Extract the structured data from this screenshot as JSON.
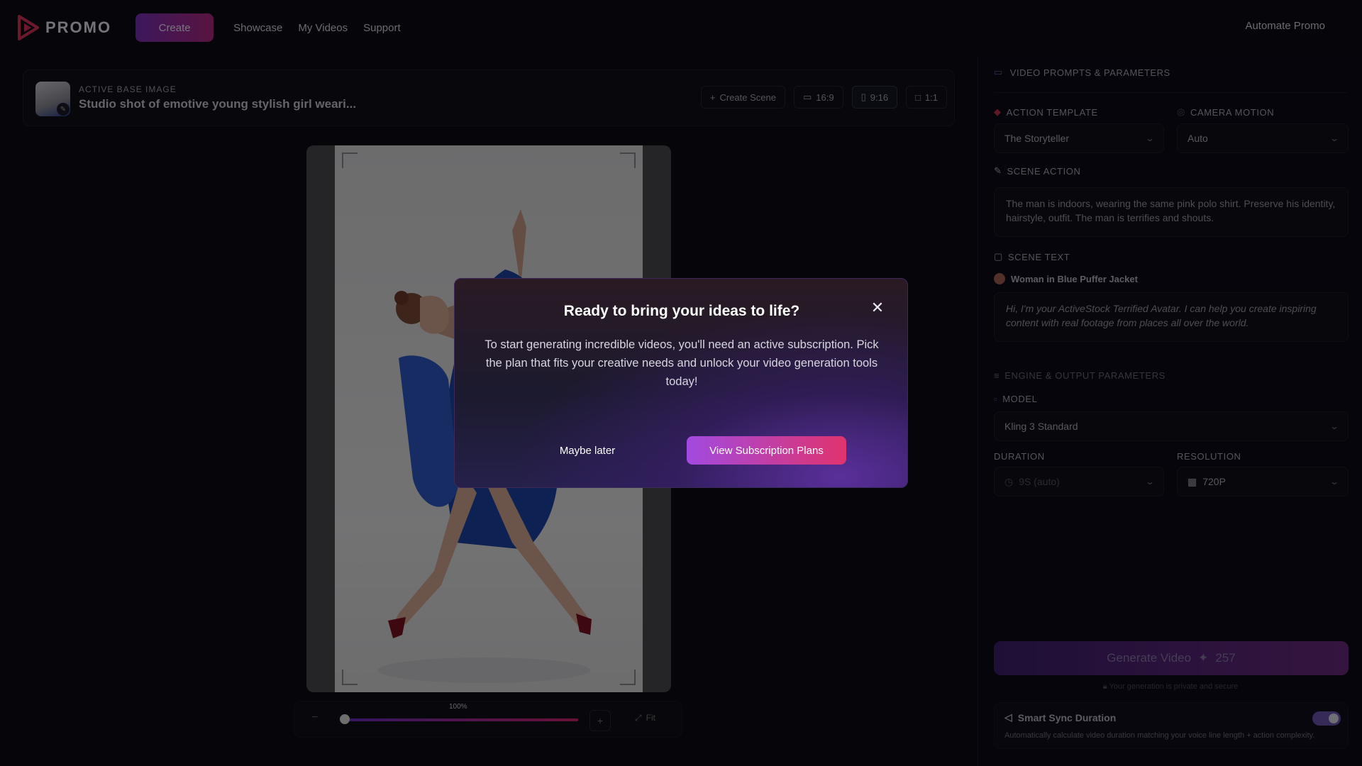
{
  "nav": {
    "logo_text": "PROMO",
    "create_label": "Create",
    "links": [
      "Showcase",
      "My Videos",
      "Support"
    ],
    "right_link": "Automate Promo"
  },
  "base_image": {
    "label": "ACTIVE BASE IMAGE",
    "title": "Studio shot of emotive young stylish girl weari...",
    "create_scene": "Create Scene",
    "ratios": [
      "16:9",
      "9:16",
      "1:1"
    ],
    "active_ratio": "9:16"
  },
  "zoom": {
    "percent": "100%",
    "level": 0.0,
    "fit_label": "Fit"
  },
  "panel": {
    "header": "VIDEO PROMPTS & PARAMETERS",
    "action_template_label": "ACTION TEMPLATE",
    "action_template_value": "The Storyteller",
    "camera_motion_label": "CAMERA MOTION",
    "camera_motion_value": "Auto",
    "scene_action_label": "SCENE ACTION",
    "scene_action_text": "The man is indoors, wearing the same pink polo shirt. Preserve his identity, hairstyle, outfit. The man is terrifies and shouts.",
    "scene_text_label": "SCENE TEXT",
    "avatar_name": "Woman in Blue Puffer Jacket",
    "scene_text": "Hi, I'm your ActiveStock Terrified Avatar. I can help you create inspiring content with real footage from places all over the world.",
    "engine_label": "ENGINE & OUTPUT PARAMETERS",
    "model_label": "MODEL",
    "model_value": "Kling 3 Standard",
    "duration_label": "DURATION",
    "duration_value": "9S (auto)",
    "resolution_label": "RESOLUTION",
    "resolution_value": "720P",
    "generate_label": "Generate Video",
    "generate_cost": "257",
    "privacy_note": "Your generation is private and secure",
    "sync_title": "Smart Sync Duration",
    "sync_desc": "Automatically calculate video duration matching your voice line length + action complexity.",
    "sync_on": true
  },
  "modal": {
    "title": "Ready to bring your ideas to life?",
    "body": "To start generating incredible videos, you'll need an active subscription. Pick the plan that fits your creative needs and unlock your video generation tools today!",
    "secondary": "Maybe later",
    "primary": "View Subscription Plans"
  },
  "colors": {
    "accent_start": "#a24ae0",
    "accent_end": "#e0336e",
    "background": "#0a0a14"
  }
}
